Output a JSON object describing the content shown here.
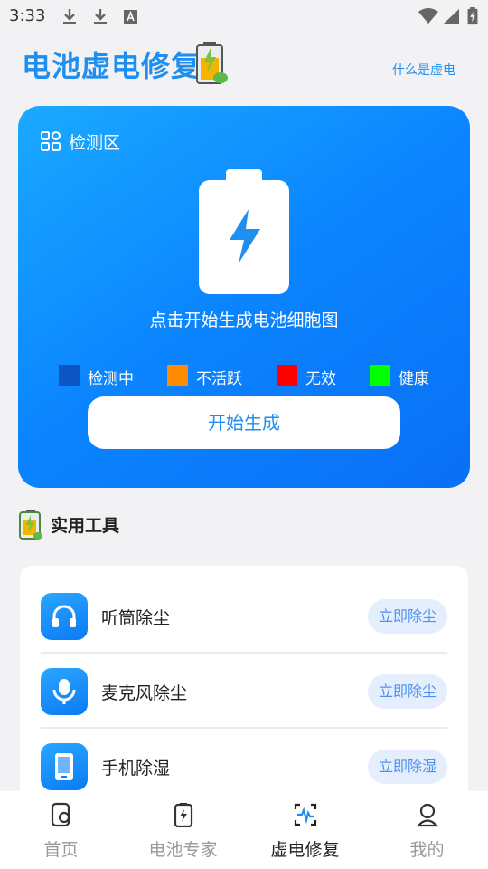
{
  "status_bar": {
    "time": "3:33"
  },
  "header": {
    "title": "电池虚电修复",
    "help_link": "什么是虚电"
  },
  "detect": {
    "section_label": "检测区",
    "hint": "点击开始生成电池细胞图",
    "legend": [
      {
        "label": "检测中",
        "color": "#0c55c2"
      },
      {
        "label": "不活跃",
        "color": "#ff8c00"
      },
      {
        "label": "无效",
        "color": "#ff0000"
      },
      {
        "label": "健康",
        "color": "#00ff00"
      }
    ],
    "start_button": "开始生成"
  },
  "tools": {
    "title": "实用工具",
    "items": [
      {
        "name": "听筒除尘",
        "action": "立即除尘",
        "icon": "headphones-icon"
      },
      {
        "name": "麦克风除尘",
        "action": "立即除尘",
        "icon": "microphone-icon"
      },
      {
        "name": "手机除湿",
        "action": "立即除湿",
        "icon": "phone-icon"
      }
    ]
  },
  "nav": {
    "items": [
      {
        "label": "首页",
        "icon": "home-icon",
        "active": false
      },
      {
        "label": "电池专家",
        "icon": "battery-icon",
        "active": false
      },
      {
        "label": "虚电修复",
        "icon": "scan-icon",
        "active": true
      },
      {
        "label": "我的",
        "icon": "user-icon",
        "active": false
      }
    ]
  },
  "colors": {
    "accent": "#1e8ff0",
    "card_gradient_start": "#1aa9ff",
    "card_gradient_end": "#0a6ff5"
  }
}
